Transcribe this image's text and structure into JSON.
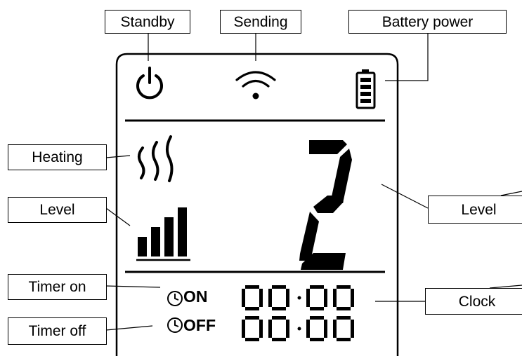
{
  "callouts": {
    "standby": "Standby",
    "sending": "Sending",
    "battery": "Battery power",
    "heating": "Heating",
    "level_left": "Level",
    "level_right": "Level",
    "timer_on": "Timer on",
    "timer_off": "Timer off",
    "clock": "Clock"
  },
  "display": {
    "timer_on_text": "ON",
    "timer_off_text": "OFF",
    "level_digit": "2",
    "clock_on": "00:00",
    "clock_off": "00:00",
    "level_bars": 4
  },
  "icons": [
    "power-icon",
    "wifi-icon",
    "battery-icon",
    "heating-waves-icon",
    "level-bars-icon",
    "clock-icon"
  ]
}
